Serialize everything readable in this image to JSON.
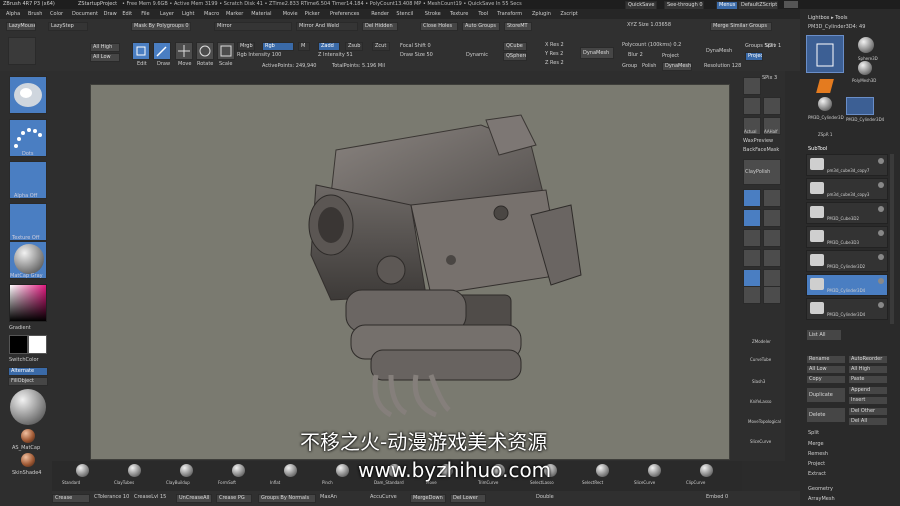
{
  "title_bar": {
    "app": "ZBrush 4R7 P3 (x64)",
    "project": "ZStartupProject",
    "stats": "• Free Mem 9.6GB • Active Mem 3199 • Scratch Disk 41 • ZTime2.833 RTime6.504 Timer14.184 • PolyCount13.408 MP • MeshCount19 • QuickSave In 55 Secs",
    "quicksave": "QuickSave",
    "see_through": "See-through 0",
    "menus_btn": "Menus",
    "script_btn": "DefaultZScript"
  },
  "menubar": [
    "Alpha",
    "Brush",
    "Color",
    "Document",
    "Draw",
    "Edit",
    "File",
    "Layer",
    "Light",
    "Macro",
    "Marker",
    "Material",
    "Movie",
    "Picker",
    "Preferences",
    "Render",
    "Stencil",
    "Stroke",
    "Texture",
    "Tool",
    "Transform",
    "Zplugin",
    "Zscript"
  ],
  "shelf": {
    "lazymouse": "LazyMouse",
    "lazystep": "LazyStep",
    "mask_by_polygroups": "Mask By Polygroups 0",
    "mirror": "Mirror",
    "mirror_weld": "Mirror And Weld",
    "del_hidden": "Del Hidden",
    "close_holes": "Close Holes",
    "auto_groups": "Auto Groups",
    "store_mt": "StoreMT",
    "dyn_sub": "XYZ Size 1.03658",
    "merge_similar": "Merge Similar Groups",
    "all_high": "All High",
    "all_low": "All Low",
    "edit": "Edit",
    "draw": "Draw",
    "move": "Move",
    "rotate": "Rotate",
    "scale": "Scale",
    "mrgb": "Mrgb",
    "rgb": "Rgb",
    "m": "M",
    "rgb_intensity": "Rgb Intensity 100",
    "zadd": "Zadd",
    "zsub": "Zsub",
    "zcut": "Zcut",
    "z_intensity": "Z Intensity 51",
    "focal_shift": "Focal Shift 0",
    "draw_size": "Draw Size 50",
    "dynamic": "Dynamic",
    "active_points": "ActivePoints: 249,940",
    "total_points": "TotalPoints: 5.196 Mil",
    "qcube": "QCube",
    "qsphere": "QSphere",
    "x_res": "X Res 2",
    "y_res": "Y Res 2",
    "z_res": "Z Res 2",
    "dynamesh": "DynaMesh",
    "polycount": "Polycount (100kms) 0.2",
    "blur": "Blur 2",
    "project": "Project",
    "group": "Group",
    "polish": "Polish",
    "resolution": "Resolution 128",
    "groups_split": "Groups Split",
    "sdiv": "SDiv 1",
    "dynamesh2": "DynaMesh"
  },
  "left": {
    "gradient": "Gradient",
    "switch_color": "SwitchColor",
    "alternate": "Alternate",
    "fill_object": "FillObject",
    "stroke_label": "Dots",
    "alpha_label": "Alpha Off",
    "texture_label": "Texture Off",
    "material_label": "MatCap Gray",
    "mat1": "AS_MatCap",
    "mat2": "SkinShade4"
  },
  "right_strip": {
    "spix": "SPix 3",
    "persp": "Persp",
    "floor": "Floor",
    "local": "Local",
    "actual": "Actual",
    "aahalf": "AAHalf",
    "wax_preview": "WaxPreview",
    "backface": "BackFaceMask",
    "claypolish": "ClayPolish",
    "line_fill": "Line Fill",
    "polyf": "PolyF",
    "transp": "Transp",
    "ghost": "Ghost",
    "solo": "Solo",
    "xpose": "Xpose",
    "solo_mode": "Solo"
  },
  "right_panel": {
    "lightbox_tools": "Lightbox ▸ Tools",
    "current_tool": "PM3D_Cylinder3D4: 49",
    "tool1": "Sphere3D",
    "tool2": "PolyMesh3D",
    "tool3": "SimpleBrush",
    "tool4": "PM3D_Cylinder3D",
    "tool5": "PM3D_Cylinder3D4",
    "tool6": "ZSpR 1",
    "subtool_title": "SubTool",
    "subtools": [
      "pm3d_cube3d_copy7",
      "pm3d_cube3d_copy3",
      "PM3D_Cube3D2",
      "PM3D_Cube3D3",
      "PM3D_Cylinder3D2",
      "PM3D_Cylinder3D4",
      "PM3D_Cylinder3D4"
    ],
    "list_all": "List All",
    "rename": "Rename",
    "auto_reorder": "AutoReorder",
    "all_low": "All Low",
    "all_high": "All High",
    "copy": "Copy",
    "paste": "Paste",
    "duplicate": "Duplicate",
    "append": "Append",
    "insert": "Insert",
    "delete": "Delete",
    "del_other": "Del Other",
    "del_all": "Del All",
    "split": "Split",
    "merge": "Merge",
    "remesh": "Remesh",
    "project": "Project",
    "extract": "Extract",
    "geometry": "Geometry",
    "arraymesh": "ArrayMesh"
  },
  "canvas_side": {
    "zmodeler": "ZModeler",
    "curve_tube": "CurveTube",
    "slash": "Slash3",
    "knife": "KnifeLasso",
    "move_topo": "MoveTopological",
    "slice_curve": "SliceCurve",
    "trim": "TrimCurve",
    "clip": "ClipCurve",
    "select_rect": "SelectRect",
    "selection": "ClipCircleCenter"
  },
  "bottom_brushes": [
    "Standard",
    "ClayTubes",
    "ClayBuildup",
    "FormSoft",
    "Inflat",
    "Pinch",
    "Dam_Standard",
    "Move",
    "TrimCurve",
    "SelectLasso",
    "SelectRect",
    "SliceCurve",
    "ClipCurve"
  ],
  "bottom_bar": {
    "crease": "Crease",
    "ctolerance": "CTolerance 10",
    "crease_lvl": "CreaseLvl 15",
    "uncrease_all": "UnCreaseAll",
    "crease_pg": "Crease PG",
    "groups_by_normals": "Groups By Normals",
    "max_angle": "MaxAn",
    "accucurve": "AccuCurve",
    "merge_down": "MergeDown",
    "del_lower": "Del Lower",
    "double": "Double",
    "embed": "Embed 0"
  },
  "watermark": {
    "chinese": "不移之火-动漫游戏美术资源",
    "url": "www.byzhihuo.com"
  },
  "colors": {
    "accent_blue": "#3a6aa8",
    "canvas_bg": "#7a7a70",
    "panel_bg": "#2b2b2b"
  }
}
